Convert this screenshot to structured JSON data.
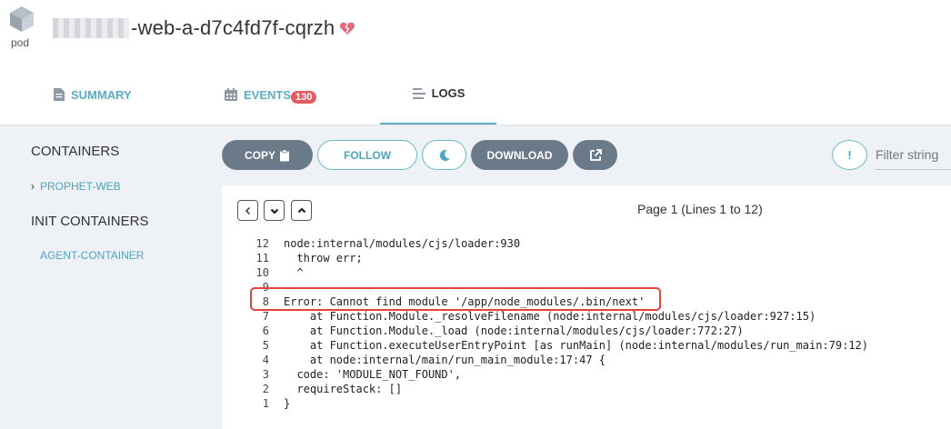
{
  "header": {
    "pod_label": "pod",
    "pod_name": "-web-a-d7c4fd7f-cqrzh",
    "status_color": "#e06b7b"
  },
  "tabs": [
    {
      "label": "SUMMARY",
      "icon": "document-icon"
    },
    {
      "label": "EVENTS",
      "icon": "calendar-icon",
      "badge": "130"
    },
    {
      "label": "LOGS",
      "icon": "lines-icon",
      "active": true
    }
  ],
  "sidebar": {
    "containers_heading": "CONTAINERS",
    "containers": [
      "PROPHET-WEB"
    ],
    "init_heading": "INIT CONTAINERS",
    "init_containers": [
      "AGENT-CONTAINER"
    ]
  },
  "toolbar": {
    "copy_label": "COPY",
    "follow_label": "FOLLOW",
    "download_label": "DOWNLOAD",
    "info_label": "!",
    "filter_placeholder": "Filter string"
  },
  "logs": {
    "page_info": "Page 1 (Lines 1 to 12)",
    "lines": [
      {
        "num": "12",
        "text": "node:internal/modules/cjs/loader:930"
      },
      {
        "num": "11",
        "text": "  throw err;"
      },
      {
        "num": "10",
        "text": "  ^"
      },
      {
        "num": "9",
        "text": ""
      },
      {
        "num": "8",
        "text": "Error: Cannot find module '/app/node_modules/.bin/next'"
      },
      {
        "num": "7",
        "text": "    at Function.Module._resolveFilename (node:internal/modules/cjs/loader:927:15)"
      },
      {
        "num": "6",
        "text": "    at Function.Module._load (node:internal/modules/cjs/loader:772:27)"
      },
      {
        "num": "5",
        "text": "    at Function.executeUserEntryPoint [as runMain] (node:internal/modules/run_main:79:12)"
      },
      {
        "num": "4",
        "text": "    at node:internal/main/run_main_module:17:47 {"
      },
      {
        "num": "3",
        "text": "  code: 'MODULE_NOT_FOUND',"
      },
      {
        "num": "2",
        "text": "  requireStack: []"
      },
      {
        "num": "1",
        "text": "}"
      }
    ],
    "highlight_color": "#e0433b"
  }
}
